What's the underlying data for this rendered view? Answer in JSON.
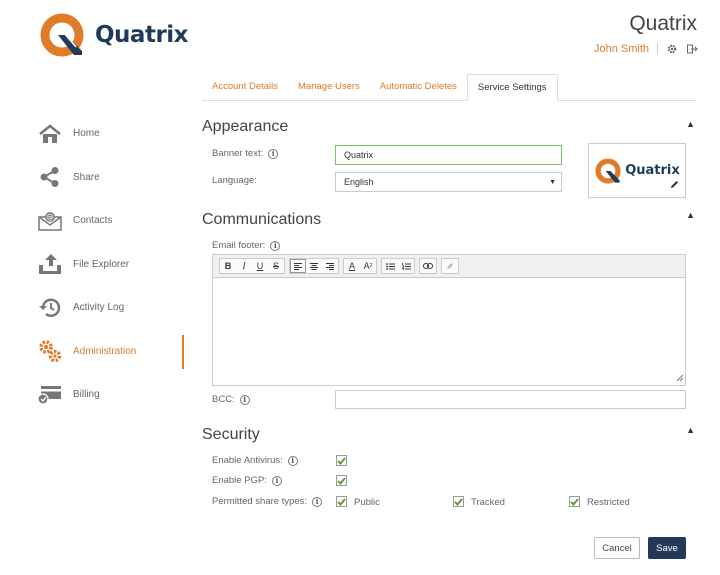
{
  "brand": {
    "logo_text": "Quatrix",
    "title": "Quatrix",
    "accent_color": "#e07b2a",
    "navy_color": "#1f3b57"
  },
  "header": {
    "user_name": "John Smith",
    "icons": [
      "gear-icon",
      "logout-icon"
    ]
  },
  "sidebar": {
    "items": [
      {
        "label": "Home",
        "icon": "home-icon"
      },
      {
        "label": "Share",
        "icon": "share-icon"
      },
      {
        "label": "Contacts",
        "icon": "contacts-icon"
      },
      {
        "label": "File Explorer",
        "icon": "upload-icon"
      },
      {
        "label": "Activity Log",
        "icon": "history-icon"
      },
      {
        "label": "Administration",
        "icon": "gears-icon",
        "active": true
      },
      {
        "label": "Billing",
        "icon": "billing-icon"
      }
    ]
  },
  "tabs": [
    {
      "label": "Account Details"
    },
    {
      "label": "Manage Users"
    },
    {
      "label": "Automatic Deletes"
    },
    {
      "label": "Service Settings",
      "active": true
    }
  ],
  "appearance": {
    "title": "Appearance",
    "banner_label": "Banner text:",
    "banner_value": "Quatrix",
    "language_label": "Language:",
    "language_value": "English",
    "preview_text": "Quatrix"
  },
  "communications": {
    "title": "Communications",
    "email_footer_label": "Email footer:",
    "email_footer_value": "",
    "toolbar": {
      "bold": "B",
      "italic": "I",
      "underline": "U",
      "strike": "S",
      "font_color": "A",
      "superscript": "A"
    },
    "bcc_label": "BCC:",
    "bcc_value": ""
  },
  "security": {
    "title": "Security",
    "antivirus_label": "Enable Antivirus:",
    "antivirus_checked": true,
    "pgp_label": "Enable PGP:",
    "pgp_checked": true,
    "share_types_label": "Permitted share types:",
    "share_types": [
      {
        "label": "Public",
        "checked": true
      },
      {
        "label": "Tracked",
        "checked": true
      },
      {
        "label": "Restricted",
        "checked": true
      }
    ]
  },
  "actions": {
    "cancel": "Cancel",
    "save": "Save"
  }
}
